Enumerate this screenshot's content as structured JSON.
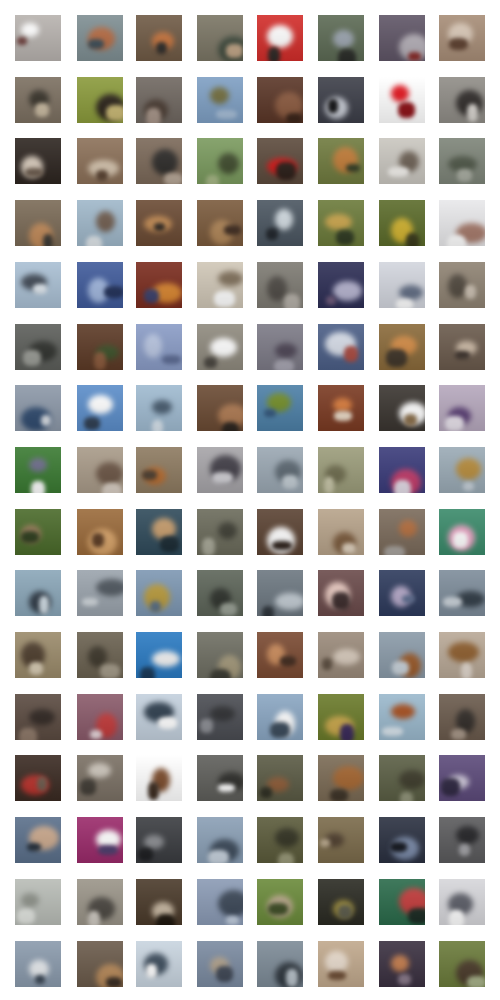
{
  "grid": {
    "rows": 16,
    "cols": 8,
    "tiles": [
      [
        {
          "bg": "#b7b2ae",
          "fg": "#ffffff",
          "accent": "#6b3c39"
        },
        {
          "bg": "#7e8e92",
          "fg": "#b56a42",
          "accent": "#3b4b55"
        },
        {
          "bg": "#6f5a45",
          "fg": "#c6733c",
          "accent": "#2d2c2a"
        },
        {
          "bg": "#7a7564",
          "fg": "#3f4a3d",
          "accent": "#c0a486"
        },
        {
          "bg": "#d22d2a",
          "fg": "#ffffff",
          "accent": "#2f2a27"
        },
        {
          "bg": "#5c6a54",
          "fg": "#9aa3ae",
          "accent": "#2c2e2a"
        },
        {
          "bg": "#5f5566",
          "fg": "#b5b0b8",
          "accent": "#8a2d2b"
        },
        {
          "bg": "#a78d77",
          "fg": "#d8c7b6",
          "accent": "#5a3d2c"
        }
      ],
      [
        {
          "bg": "#7b6f60",
          "fg": "#363128",
          "accent": "#c8b9a0"
        },
        {
          "bg": "#8a9a3b",
          "fg": "#2b231a",
          "accent": "#c9b874"
        },
        {
          "bg": "#6f6760",
          "fg": "#4a3c33",
          "accent": "#a8968a"
        },
        {
          "bg": "#7e9fc3",
          "fg": "#6f6a3b",
          "accent": "#a6bdd6"
        },
        {
          "bg": "#5a3627",
          "fg": "#8b5a3f",
          "accent": "#3a2419"
        },
        {
          "bg": "#3c3e48",
          "fg": "#c9cdd6",
          "accent": "#101012"
        },
        {
          "bg": "#ffffff",
          "fg": "#e0111a",
          "accent": "#8b0e14"
        },
        {
          "bg": "#8f8c86",
          "fg": "#2f2b29",
          "accent": "#d8d4cf"
        }
      ],
      [
        {
          "bg": "#2d2520",
          "fg": "#d9ccbd",
          "accent": "#6a5a4c"
        },
        {
          "bg": "#8b7058",
          "fg": "#d5c4ae",
          "accent": "#5a4332"
        },
        {
          "bg": "#7a6858",
          "fg": "#2c2a28",
          "accent": "#b8a898"
        },
        {
          "bg": "#7a9a5e",
          "fg": "#3e4a2c",
          "accent": "#a8b887"
        },
        {
          "bg": "#5c4a3c",
          "fg": "#d31717",
          "accent": "#2a1e18"
        },
        {
          "bg": "#6f7a3e",
          "fg": "#c07a36",
          "accent": "#2f3a22"
        },
        {
          "bg": "#c9c6bf",
          "fg": "#6b5f53",
          "accent": "#f2f0ec"
        },
        {
          "bg": "#7d8478",
          "fg": "#4d5546",
          "accent": "#a9ada2"
        }
      ],
      [
        {
          "bg": "#7a6a56",
          "fg": "#c28b5a",
          "accent": "#3c3a35"
        },
        {
          "bg": "#9fb7c9",
          "fg": "#6d5a4c",
          "accent": "#e0e6ea"
        },
        {
          "bg": "#6a4a33",
          "fg": "#c28a52",
          "accent": "#2d2620"
        },
        {
          "bg": "#7a5a3c",
          "fg": "#b08658",
          "accent": "#3e2b1f"
        },
        {
          "bg": "#4a5560",
          "fg": "#cfd8de",
          "accent": "#1e2329"
        },
        {
          "bg": "#6b7a3a",
          "fg": "#c9a34a",
          "accent": "#2f3a22"
        },
        {
          "bg": "#5b6b2a",
          "fg": "#d1b22f",
          "accent": "#3a3a1c"
        },
        {
          "bg": "#e8e8ea",
          "fg": "#a5796a",
          "accent": "#ffffff"
        }
      ],
      [
        {
          "bg": "#a9bfd3",
          "fg": "#3d4652",
          "accent": "#dde5ec"
        },
        {
          "bg": "#3f5a9a",
          "fg": "#9fb5dc",
          "accent": "#1f2e56"
        },
        {
          "bg": "#7a2c1e",
          "fg": "#d8852f",
          "accent": "#3a3f6a"
        },
        {
          "bg": "#cfc6b6",
          "fg": "#7a6a55",
          "accent": "#ffffff"
        },
        {
          "bg": "#7d7a72",
          "fg": "#4c4843",
          "accent": "#b5b0a8"
        },
        {
          "bg": "#2d2e55",
          "fg": "#b5b3cf",
          "accent": "#6e5a7a"
        },
        {
          "bg": "#d2d5dd",
          "fg": "#5f6b82",
          "accent": "#ffffff"
        },
        {
          "bg": "#8e8272",
          "fg": "#4e463c",
          "accent": "#c9beb0"
        }
      ],
      [
        {
          "bg": "#5c5e5a",
          "fg": "#2e302c",
          "accent": "#9a9c96"
        },
        {
          "bg": "#5c3a26",
          "fg": "#3a5028",
          "accent": "#8a5a3c"
        },
        {
          "bg": "#8a9cc6",
          "fg": "#b7c4df",
          "accent": "#5b6a92"
        },
        {
          "bg": "#8f8a7e",
          "fg": "#ffffff",
          "accent": "#4a4640"
        },
        {
          "bg": "#7c7a86",
          "fg": "#4a4252",
          "accent": "#a9a7b3"
        },
        {
          "bg": "#4b5e86",
          "fg": "#d5dbe6",
          "accent": "#a8493f"
        },
        {
          "bg": "#8a6a3a",
          "fg": "#d28a44",
          "accent": "#3e3428"
        },
        {
          "bg": "#6a5a4c",
          "fg": "#cbb9a5",
          "accent": "#3a302a"
        }
      ],
      [
        {
          "bg": "#8c98a8",
          "fg": "#2f4a6e",
          "accent": "#d8dde3"
        },
        {
          "bg": "#5b8dc9",
          "fg": "#ffffff",
          "accent": "#2f3e52"
        },
        {
          "bg": "#9fbad0",
          "fg": "#43576a",
          "accent": "#d9e4ed"
        },
        {
          "bg": "#6a4a33",
          "fg": "#ae7a52",
          "accent": "#2d2620"
        },
        {
          "bg": "#4c7fa6",
          "fg": "#6f8a25",
          "accent": "#2f5277"
        },
        {
          "bg": "#7a3a22",
          "fg": "#d77a3a",
          "accent": "#e9d9c6"
        },
        {
          "bg": "#3a3530",
          "fg": "#ffffff",
          "accent": "#8a6e4a"
        },
        {
          "bg": "#b6a8bd",
          "fg": "#5a3f74",
          "accent": "#e9e3ec"
        }
      ],
      [
        {
          "bg": "#3a7a32",
          "fg": "#6c6a8a",
          "accent": "#ffffff"
        },
        {
          "bg": "#a89a88",
          "fg": "#6a5444",
          "accent": "#d9cfc4"
        },
        {
          "bg": "#8d7a60",
          "fg": "#b56a2e",
          "accent": "#4a3c2e"
        },
        {
          "bg": "#a6a4a8",
          "fg": "#3f3c45",
          "accent": "#d0cfd4"
        },
        {
          "bg": "#9aa7b2",
          "fg": "#5a6670",
          "accent": "#c2ccd3"
        },
        {
          "bg": "#9b9c7a",
          "fg": "#6c6a4c",
          "accent": "#c8c6a9"
        },
        {
          "bg": "#3a3b7a",
          "fg": "#c23b6a",
          "accent": "#e4dde8"
        },
        {
          "bg": "#9aaab5",
          "fg": "#b58a3a",
          "accent": "#c7d1d9"
        }
      ],
      [
        {
          "bg": "#4a6a2a",
          "fg": "#9a7a5a",
          "accent": "#2a3a1a"
        },
        {
          "bg": "#9a6a3a",
          "fg": "#d8a46a",
          "accent": "#5a3a22"
        },
        {
          "bg": "#2f4a5a",
          "fg": "#c49a6a",
          "accent": "#1a2a33"
        },
        {
          "bg": "#6a6a5a",
          "fg": "#3a3a30",
          "accent": "#a8a898"
        },
        {
          "bg": "#5a4232",
          "fg": "#ffffff",
          "accent": "#2d211a"
        },
        {
          "bg": "#b7a38a",
          "fg": "#7a5a3c",
          "accent": "#e0d2bf"
        },
        {
          "bg": "#7a6a5a",
          "fg": "#b06a3a",
          "accent": "#a9a49f"
        },
        {
          "bg": "#3a8a6a",
          "fg": "#e9a2c2",
          "accent": "#ffffff"
        }
      ],
      [
        {
          "bg": "#8aa6b8",
          "fg": "#2f3a46",
          "accent": "#d1dde5"
        },
        {
          "bg": "#9aa3ac",
          "fg": "#4a525a",
          "accent": "#cfd5da"
        },
        {
          "bg": "#7d97b2",
          "fg": "#b89a3c",
          "accent": "#5a6f84"
        },
        {
          "bg": "#5c6458",
          "fg": "#2d312b",
          "accent": "#9aa196"
        },
        {
          "bg": "#6c7780",
          "fg": "#c3ccd3",
          "accent": "#2f363c"
        },
        {
          "bg": "#6a4a4a",
          "fg": "#e8c9c0",
          "accent": "#3a2a2a"
        },
        {
          "bg": "#2d3a5c",
          "fg": "#b5a8c8",
          "accent": "#5a6a8c"
        },
        {
          "bg": "#7d8c9a",
          "fg": "#2f3a44",
          "accent": "#c9d1d8"
        }
      ],
      [
        {
          "bg": "#9a8a6a",
          "fg": "#4a3a2a",
          "accent": "#d8ccb4"
        },
        {
          "bg": "#6a6150",
          "fg": "#3a3428",
          "accent": "#a59c8a"
        },
        {
          "bg": "#2a7ac2",
          "fg": "#f2f2f2",
          "accent": "#1a3a5a"
        },
        {
          "bg": "#6e6e62",
          "fg": "#a59a7c",
          "accent": "#3e3e36"
        },
        {
          "bg": "#7a4a32",
          "fg": "#c98a5a",
          "accent": "#3e281c"
        },
        {
          "bg": "#9a8a7a",
          "fg": "#d6c9bb",
          "accent": "#5a4c3e"
        },
        {
          "bg": "#8a9aa8",
          "fg": "#9a5a2a",
          "accent": "#c9d3db"
        },
        {
          "bg": "#b8a896",
          "fg": "#8a5a2a",
          "accent": "#e2d8ce"
        }
      ],
      [
        {
          "bg": "#5a4a40",
          "fg": "#2d241f",
          "accent": "#8f7a6a"
        },
        {
          "bg": "#8a5a6a",
          "fg": "#c23a3a",
          "accent": "#e8d8dc"
        },
        {
          "bg": "#c3d0dd",
          "fg": "#2a3a4a",
          "accent": "#ffffff"
        },
        {
          "bg": "#4a4c52",
          "fg": "#2a2b2e",
          "accent": "#8b8d93"
        },
        {
          "bg": "#8aa6c2",
          "fg": "#ffffff",
          "accent": "#3a4a5a"
        },
        {
          "bg": "#6a7a2a",
          "fg": "#c9a64a",
          "accent": "#3a2a5a"
        },
        {
          "bg": "#9ab8cc",
          "fg": "#a24a1a",
          "accent": "#d9e4ec"
        },
        {
          "bg": "#6a5a4c",
          "fg": "#2f2a26",
          "accent": "#a89889"
        }
      ],
      [
        {
          "bg": "#3a2a22",
          "fg": "#b8302a",
          "accent": "#6a5a4c"
        },
        {
          "bg": "#7a7064",
          "fg": "#c9c2b8",
          "accent": "#3f3a33"
        },
        {
          "bg": "#ffffff",
          "fg": "#7a4a2a",
          "accent": "#3a2a1e"
        },
        {
          "bg": "#5e5e5a",
          "fg": "#2b2b28",
          "accent": "#ffffff"
        },
        {
          "bg": "#5a5a44",
          "fg": "#8c5a36",
          "accent": "#2e2e22"
        },
        {
          "bg": "#7a6a54",
          "fg": "#a2632e",
          "accent": "#3e3428"
        },
        {
          "bg": "#5a5e44",
          "fg": "#3a3828",
          "accent": "#93967c"
        },
        {
          "bg": "#5c4a7a",
          "fg": "#d0cadb",
          "accent": "#2d2640"
        }
      ],
      [
        {
          "bg": "#5a6f8a",
          "fg": "#c8a68a",
          "accent": "#1f2a36"
        },
        {
          "bg": "#9a2a6a",
          "fg": "#ffffff",
          "accent": "#4a3a6a"
        },
        {
          "bg": "#3a3c40",
          "fg": "#8a8c90",
          "accent": "#1c1d20"
        },
        {
          "bg": "#8a9fb5",
          "fg": "#3c4a5a",
          "accent": "#c9d4df"
        },
        {
          "bg": "#5a5a3a",
          "fg": "#2e2e1e",
          "accent": "#9a9a7a"
        },
        {
          "bg": "#7a6a4a",
          "fg": "#4a3a2a",
          "accent": "#b7a68a"
        },
        {
          "bg": "#2a3040",
          "fg": "#7a8aa8",
          "accent": "#11141c"
        },
        {
          "bg": "#5a5a5c",
          "fg": "#1f1f22",
          "accent": "#a2a2a6"
        }
      ],
      [
        {
          "bg": "#b8bcb6",
          "fg": "#8a8e86",
          "accent": "#e2e5e0"
        },
        {
          "bg": "#9a9488",
          "fg": "#4a4640",
          "accent": "#cfcac2"
        },
        {
          "bg": "#4a3a2a",
          "fg": "#c8b8a2",
          "accent": "#1f180f"
        },
        {
          "bg": "#8a9ab4",
          "fg": "#3a4656",
          "accent": "#c3cfdf"
        },
        {
          "bg": "#6a8a3a",
          "fg": "#b8a68a",
          "accent": "#3a4a22"
        },
        {
          "bg": "#2a2a22",
          "fg": "#9a8a3a",
          "accent": "#5a5a4a"
        },
        {
          "bg": "#2a6a4a",
          "fg": "#c23a3a",
          "accent": "#1a2a22"
        },
        {
          "bg": "#d6d6da",
          "fg": "#5a5c66",
          "accent": "#ffffff"
        }
      ],
      [
        {
          "bg": "#8a9aac",
          "fg": "#e6e9ec",
          "accent": "#3a4654"
        },
        {
          "bg": "#6a5a4a",
          "fg": "#b88a5a",
          "accent": "#3a2e24"
        },
        {
          "bg": "#c8d4df",
          "fg": "#3a4a5a",
          "accent": "#ffffff"
        },
        {
          "bg": "#7a8aa0",
          "fg": "#b0a08a",
          "accent": "#3e4654"
        },
        {
          "bg": "#7c8a96",
          "fg": "#2e363e",
          "accent": "#b8c2ca"
        },
        {
          "bg": "#c0a88c",
          "fg": "#e6d9cb",
          "accent": "#6a4a32"
        },
        {
          "bg": "#3a3040",
          "fg": "#c27a4a",
          "accent": "#8a7a8a"
        },
        {
          "bg": "#6a7a3a",
          "fg": "#4a3a2a",
          "accent": "#a8b28a"
        }
      ]
    ]
  }
}
